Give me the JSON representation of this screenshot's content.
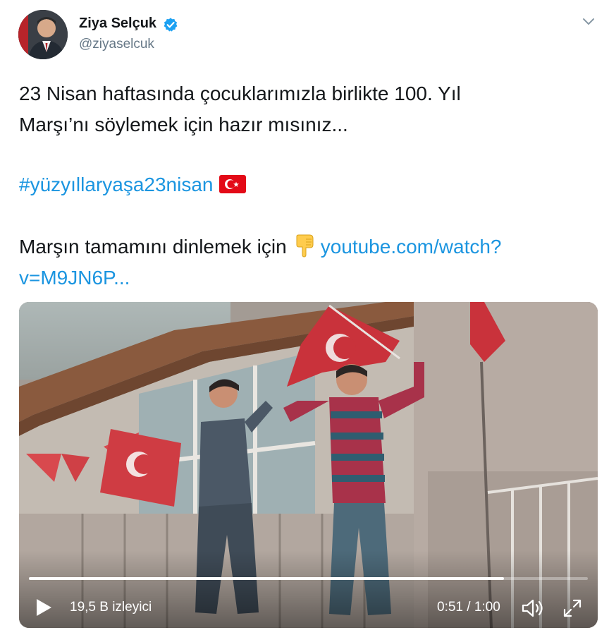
{
  "author": {
    "name": "Ziya Selçuk",
    "handle": "@ziyaselcuk",
    "verified_icon": "verified-badge-icon",
    "menu_icon": "chevron-down-icon"
  },
  "tweet": {
    "line1": "23 Nisan haftasında çocuklarımızla birlikte 100. Yıl",
    "line2": "Marşı’nı söylemek için hazır mısınız...",
    "hashtag": "#yüzyıllaryaşa23nisan",
    "line3_text": "Marşın tamamını dinlemek için",
    "link_part1": "youtube.com/watch?",
    "link_part2": "v=M9JN6P...",
    "emoji_flag": "turkey-flag-icon",
    "emoji_hand": "backhand-index-pointing-down-icon"
  },
  "video": {
    "views": "19,5 B izleyici",
    "time": "0:51 / 1:00",
    "progress": 0.85,
    "play_icon": "play-icon",
    "volume_icon": "volume-icon",
    "fullscreen_icon": "fullscreen-icon"
  },
  "colors": {
    "link": "#1b95e0",
    "verified": "#1da1f2",
    "flag_red": "#e30a17"
  }
}
